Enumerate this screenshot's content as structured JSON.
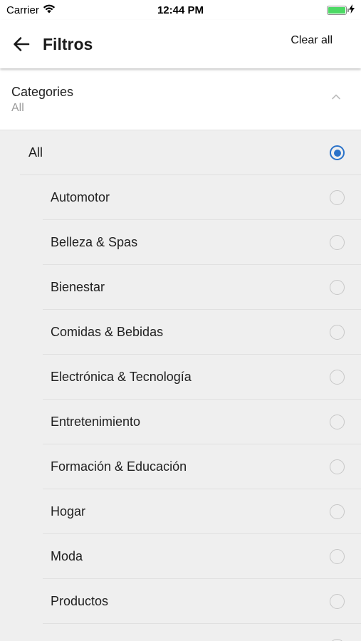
{
  "status_bar": {
    "carrier": "Carrier",
    "time": "12:44 PM"
  },
  "app_bar": {
    "title": "Filtros",
    "clear_label": "Clear all"
  },
  "categories": {
    "title": "Categories",
    "selected": "All"
  },
  "options": {
    "all": {
      "label": "All",
      "selected": true
    },
    "items": [
      {
        "label": "Automotor",
        "selected": false
      },
      {
        "label": "Belleza & Spas",
        "selected": false
      },
      {
        "label": "Bienestar",
        "selected": false
      },
      {
        "label": "Comidas & Bebidas",
        "selected": false
      },
      {
        "label": "Electrónica & Tecnología",
        "selected": false
      },
      {
        "label": "Entretenimiento",
        "selected": false
      },
      {
        "label": "Formación & Educación",
        "selected": false
      },
      {
        "label": "Hogar",
        "selected": false
      },
      {
        "label": "Moda",
        "selected": false
      },
      {
        "label": "Productos",
        "selected": false
      }
    ]
  },
  "colors": {
    "accent": "#2a72c9",
    "list_background": "#efefef",
    "battery": "#4cd964"
  }
}
